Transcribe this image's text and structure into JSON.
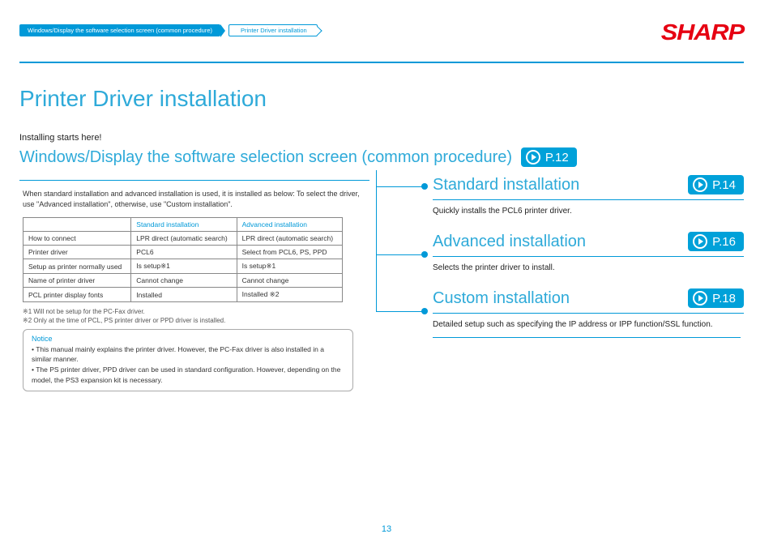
{
  "breadcrumb": {
    "item1": "Windows/Display the software selection screen (common procedure)",
    "item2": "Printer Driver installation"
  },
  "brand": "SHARP",
  "title": "Printer Driver installation",
  "intro": "Installing starts here!",
  "subheading": "Windows/Display the software selection screen (common procedure)",
  "subheading_page": "P.12",
  "body_text": "When standard installation and advanced installation is used, it is installed as below:  To select the driver, use \"Advanced installation\", otherwise, use \"Custom installation\".",
  "table": {
    "headers": [
      "",
      "Standard installation",
      "Advanced installation"
    ],
    "rows": [
      [
        "How to connect",
        "LPR direct (automatic search)",
        "LPR direct (automatic search)"
      ],
      [
        "Printer driver",
        "PCL6",
        "Select from PCL6, PS, PPD"
      ],
      [
        "Setup as printer normally used",
        "Is setup※1",
        "Is setup※1"
      ],
      [
        "Name of printer driver",
        "Cannot change",
        "Cannot change"
      ],
      [
        "PCL printer display fonts",
        "Installed",
        "Installed ※2"
      ]
    ]
  },
  "footnotes": {
    "f1": "※1 Will not be setup for the PC-Fax driver.",
    "f2": "※2 Only at the time of PCL, PS printer driver or PPD driver is installed."
  },
  "notice": {
    "title": "Notice",
    "line1": "This manual mainly explains the printer driver. However, the PC-Fax driver is also installed in a similar manner.",
    "line2": "The PS printer driver, PPD driver can be used in standard configuration. However, depending on the model, the PS3 expansion kit is necessary."
  },
  "sections": [
    {
      "title": "Standard installation",
      "page": "P.14",
      "desc": "Quickly installs the PCL6 printer driver."
    },
    {
      "title": "Advanced installation",
      "page": "P.16",
      "desc": "Selects the printer driver to install."
    },
    {
      "title": "Custom installation",
      "page": "P.18",
      "desc": "Detailed setup such as specifying the IP address or IPP function/SSL function."
    }
  ],
  "page_number": "13"
}
